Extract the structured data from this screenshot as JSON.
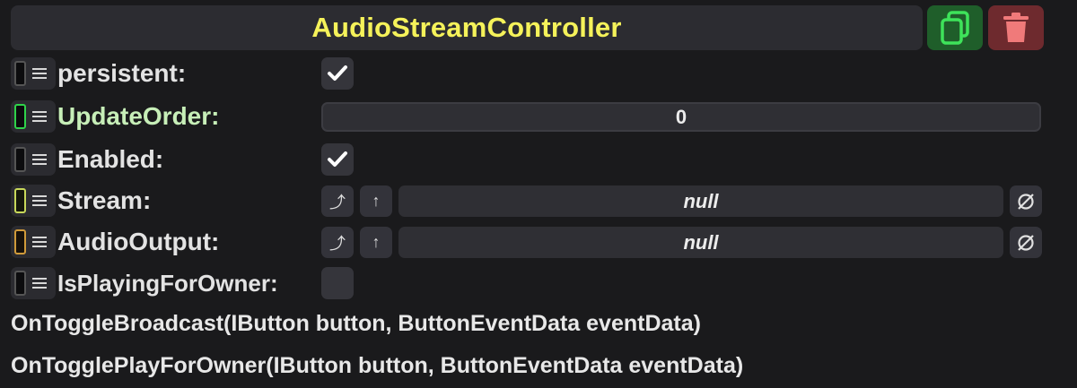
{
  "header": {
    "title": "AudioStreamController"
  },
  "colors": {
    "title": "#f5f25a",
    "duplicate_button": "#1f5e2a",
    "duplicate_icon": "#3ee35a",
    "delete_button": "#6e2a2e",
    "delete_icon": "#f07a7a",
    "slot_green": "#2fd24a",
    "slot_yellow": "#c8d85a",
    "slot_orange": "#d09a3a"
  },
  "fields": {
    "persistent": {
      "label": "persistent:",
      "checked": true
    },
    "update_order": {
      "label": "UpdateOrder:",
      "value": "0"
    },
    "enabled": {
      "label": "Enabled:",
      "checked": true
    },
    "stream": {
      "label": "Stream:",
      "value": "null"
    },
    "audio_output": {
      "label": "AudioOutput:",
      "value": "null"
    },
    "is_playing_for_owner": {
      "label": "IsPlayingForOwner:",
      "checked": false
    }
  },
  "methods": [
    "OnToggleBroadcast(IButton button, ButtonEventData eventData)",
    "OnTogglePlayForOwner(IButton button, ButtonEventData eventData)"
  ],
  "buttons": {
    "jump_glyph": "⤴",
    "up_glyph": "↑"
  }
}
